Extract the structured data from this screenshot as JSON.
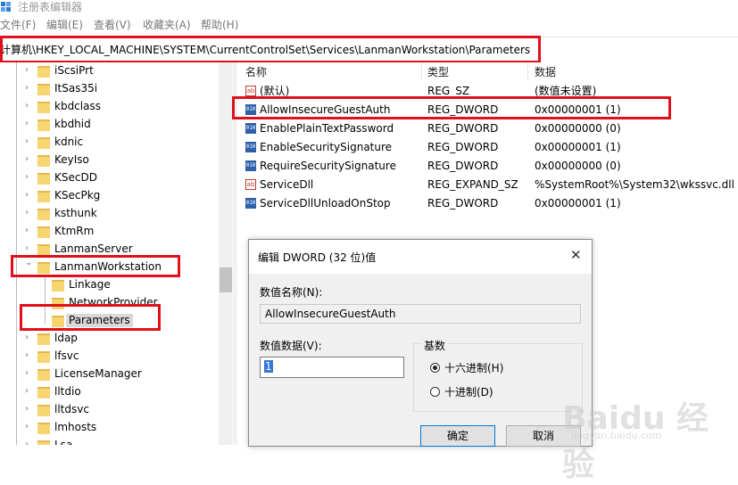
{
  "window": {
    "title": "注册表编辑器"
  },
  "menu": [
    "文件(F)",
    "编辑(E)",
    "查看(V)",
    "收藏夹(A)",
    "帮助(H)"
  ],
  "address": "计算机\\HKEY_LOCAL_MACHINE\\SYSTEM\\CurrentControlSet\\Services\\LanmanWorkstation\\Parameters",
  "tree": {
    "items": [
      "iScsiPrt",
      "ItSas35i",
      "kbdclass",
      "kbdhid",
      "kdnic",
      "KeyIso",
      "KSecDD",
      "KSecPkg",
      "ksthunk",
      "KtmRm",
      "LanmanServer",
      "LanmanWorkstation",
      "Linkage",
      "NetworkProvider",
      "Parameters",
      "ldap",
      "lfsvc",
      "LicenseManager",
      "lltdio",
      "lltdsvc",
      "lmhosts",
      "Lsa"
    ]
  },
  "values_list": {
    "headers": {
      "name": "名称",
      "type": "类型",
      "data": "数据"
    },
    "rows": [
      {
        "name": "(默认)",
        "type": "REG_SZ",
        "data": "(数值未设置)",
        "icon": "string-icon"
      },
      {
        "name": "AllowInsecureGuestAuth",
        "type": "REG_DWORD",
        "data": "0x00000001 (1)",
        "icon": "binary-icon"
      },
      {
        "name": "EnablePlainTextPassword",
        "type": "REG_DWORD",
        "data": "0x00000000 (0)",
        "icon": "binary-icon"
      },
      {
        "name": "EnableSecuritySignature",
        "type": "REG_DWORD",
        "data": "0x00000001 (1)",
        "icon": "binary-icon"
      },
      {
        "name": "RequireSecuritySignature",
        "type": "REG_DWORD",
        "data": "0x00000000 (0)",
        "icon": "binary-icon"
      },
      {
        "name": "ServiceDll",
        "type": "REG_EXPAND_SZ",
        "data": "%SystemRoot%\\System32\\wkssvc.dll",
        "icon": "string-icon"
      },
      {
        "name": "ServiceDllUnloadOnStop",
        "type": "REG_DWORD",
        "data": "0x00000001 (1)",
        "icon": "binary-icon"
      }
    ]
  },
  "dialog": {
    "title": "编辑 DWORD (32 位)值",
    "name_label": "数值名称(N):",
    "name_value": "AllowInsecureGuestAuth",
    "data_label": "数值数据(V):",
    "data_value": "1",
    "base_label": "基数",
    "radio_hex": "十六进制(H)",
    "radio_dec": "十进制(D)",
    "selected_base": "hex",
    "ok": "确定",
    "cancel": "取消"
  },
  "watermark": {
    "text": "Baidu 经验",
    "sub": "jingyan.baidu.com"
  },
  "colors": {
    "highlight": "#e0101a",
    "folder": "#f7d570",
    "selection": "#3478d8"
  }
}
